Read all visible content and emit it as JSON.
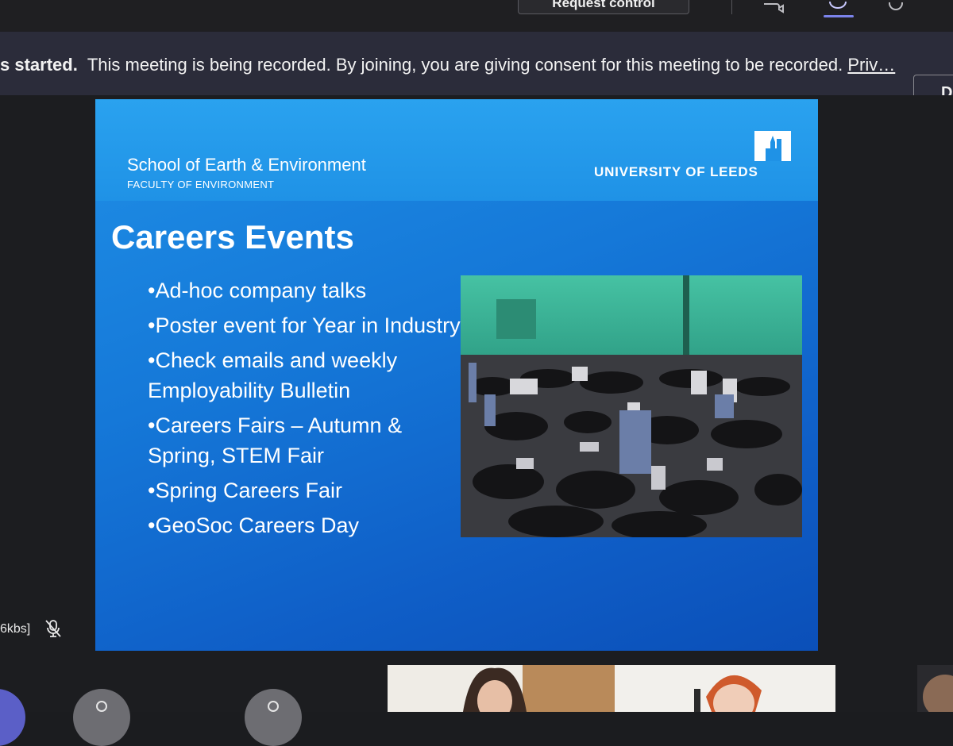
{
  "toolbar": {
    "request_control_label": "Request control",
    "icons": [
      "camera-icon",
      "chat-icon",
      "participants-icon"
    ]
  },
  "banner": {
    "bold_text": "s started.",
    "message": "This meeting is being recorded. By joining, you are giving consent for this meeting to be recorded.",
    "link_text": "Priv…",
    "dismiss_label": "D"
  },
  "slide": {
    "school": "School of Earth & Environment",
    "faculty": "FACULTY OF ENVIRONMENT",
    "university": "UNIVERSITY OF LEEDS",
    "title": "Careers Events",
    "bullets": [
      "•Ad-hoc company talks",
      "•Poster event for Year in Industry",
      "•Check emails and weekly Employability Bulletin",
      "•Careers Fairs – Autumn & Spring, STEM Fair",
      "•Spring Careers Fair",
      "•GeoSoc Careers Day"
    ],
    "colors": {
      "slide_blue": "#1578d8",
      "header_blue": "#2aa2ef",
      "hall_green": "#3fb79a"
    }
  },
  "meeting": {
    "bitrate": "6kbs]",
    "mic_icon": "microphone-off-icon"
  }
}
